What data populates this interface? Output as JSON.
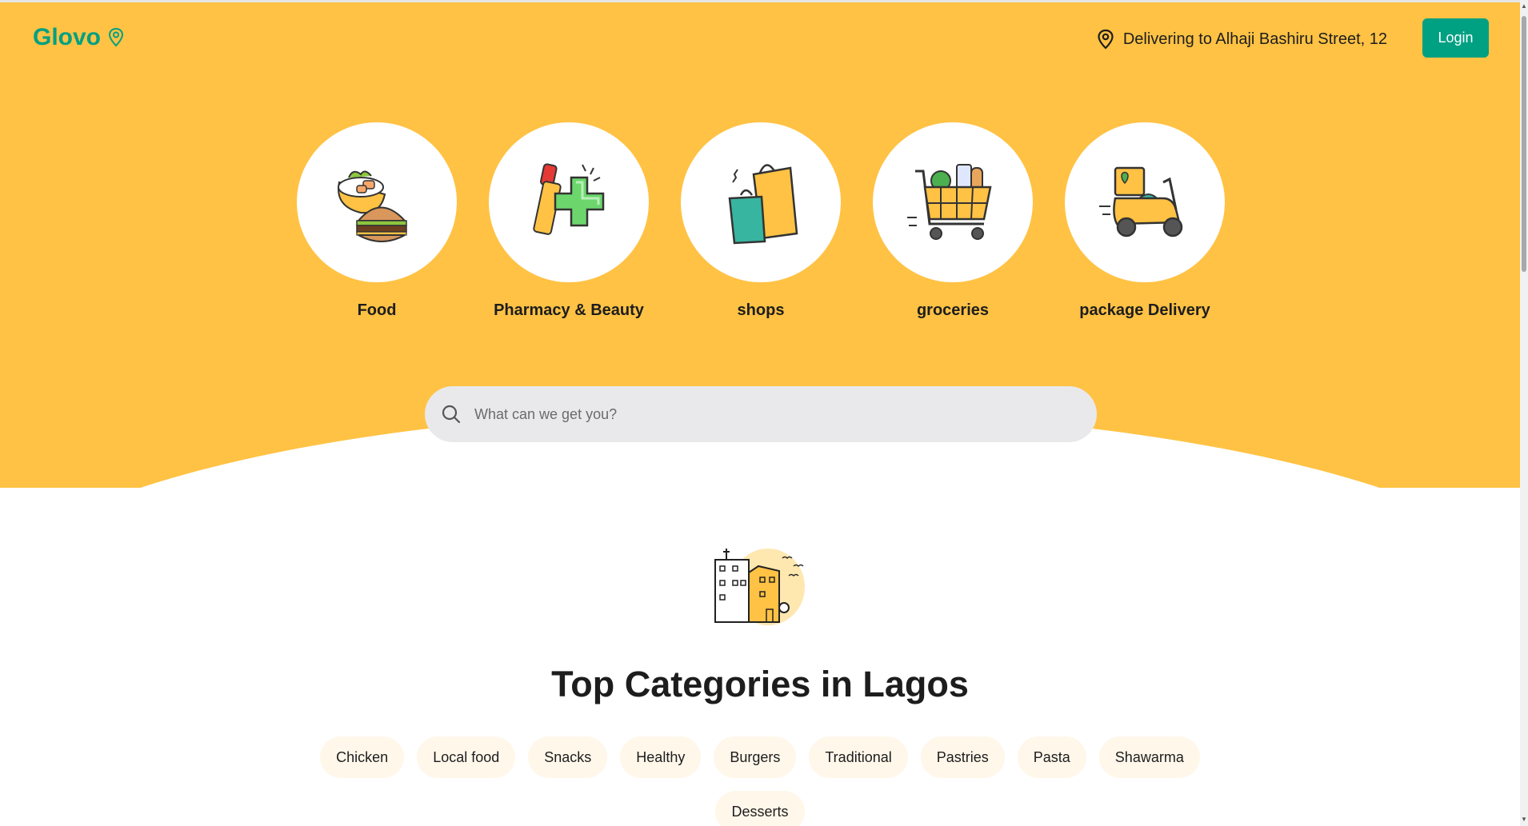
{
  "header": {
    "logo": "Glovo",
    "delivery_text": "Delivering to Alhaji Bashiru Street, 12",
    "login_label": "Login"
  },
  "categories": [
    {
      "label": "Food",
      "icon": "food-icon"
    },
    {
      "label": "Pharmacy & Beauty",
      "icon": "pharmacy-icon"
    },
    {
      "label": "shops",
      "icon": "shopping-bags-icon"
    },
    {
      "label": "groceries",
      "icon": "grocery-cart-icon"
    },
    {
      "label": "package Delivery",
      "icon": "delivery-scooter-icon"
    }
  ],
  "search": {
    "placeholder": "What can we get you?",
    "value": ""
  },
  "section": {
    "title": "Top Categories in Lagos",
    "chips": [
      "Chicken",
      "Local food",
      "Snacks",
      "Healthy",
      "Burgers",
      "Traditional",
      "Pastries",
      "Pasta",
      "Shawarma",
      "Desserts"
    ]
  },
  "colors": {
    "brand_yellow": "#ffc244",
    "brand_green": "#00a082",
    "chip_bg": "#fff7ea"
  }
}
